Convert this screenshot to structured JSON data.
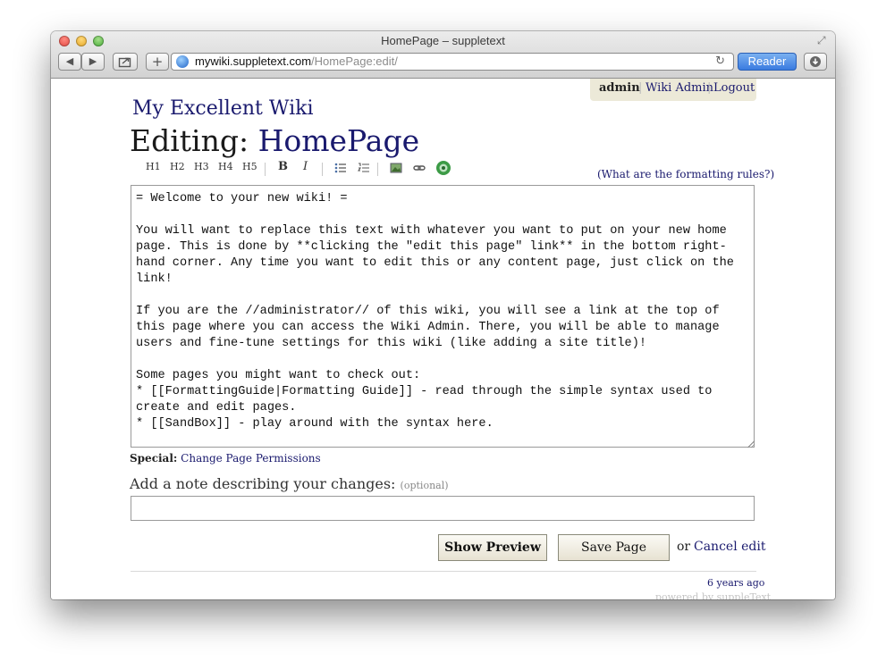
{
  "window": {
    "title": "HomePage – suppletext",
    "url_host": "mywiki.suppletext.com",
    "url_path": "/HomePage:edit/",
    "reader_label": "Reader",
    "back_glyph": "◀",
    "forward_glyph": "▶",
    "new_tab_glyph": "+",
    "reload_glyph": "↻",
    "fullscreen_glyph": "⤢"
  },
  "userbar": {
    "user": "admin",
    "admin_link": "Wiki Admin",
    "logout_link": "Logout"
  },
  "site_title": "My Excellent Wiki",
  "heading": {
    "prefix": "Editing:",
    "page_name": "HomePage"
  },
  "toolbar": {
    "h1": "H1",
    "h2": "H2",
    "h3": "H3",
    "h4": "H4",
    "h5": "H5",
    "bold": "B",
    "italic": "I",
    "formatting_rules_link": "(What are the formatting rules?)"
  },
  "editor_text": "= Welcome to your new wiki! =\n\nYou will want to replace this text with whatever you want to put on your new home page. This is done by **clicking the \"edit this page\" link** in the bottom right-hand corner. Any time you want to edit this or any content page, just click on the link!\n\nIf you are the //administrator// of this wiki, you will see a link at the top of this page where you can access the Wiki Admin. There, you will be able to manage users and fine-tune settings for this wiki (like adding a site title)!\n\nSome pages you might want to check out:\n* [[FormattingGuide|Formatting Guide]] - read through the simple syntax used to create and edit pages.\n* [[SandBox]] - play around with the syntax here.",
  "special": {
    "label": "Special:",
    "link": "Change Page Permissions"
  },
  "note": {
    "label": "Add a note describing your changes:",
    "optional": "(optional)",
    "value": ""
  },
  "actions": {
    "preview": "Show Preview",
    "save": "Save Page",
    "or": "or",
    "cancel": "Cancel edit"
  },
  "footer": {
    "age": "6 years ago",
    "powered": "powered by suppleText"
  },
  "colors": {
    "link": "#1a1a6e",
    "reader_button": "#3a7be0",
    "userbar_bg": "#ece9d8"
  }
}
